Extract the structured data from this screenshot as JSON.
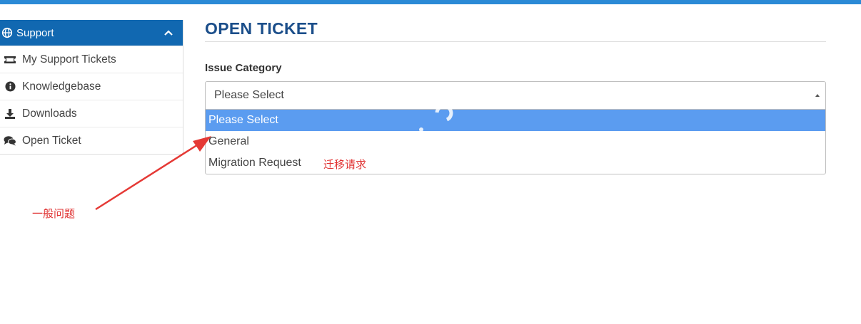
{
  "sidebar": {
    "header_label": "Support",
    "items": [
      {
        "label": "My Support Tickets",
        "icon": "ticket-icon"
      },
      {
        "label": "Knowledgebase",
        "icon": "info-circle-icon"
      },
      {
        "label": "Downloads",
        "icon": "download-icon"
      },
      {
        "label": "Open Ticket",
        "icon": "comments-icon"
      }
    ]
  },
  "main": {
    "title": "OPEN TICKET",
    "issue_category": {
      "label": "Issue Category",
      "selected": "Please Select",
      "options": [
        "Please Select",
        "General",
        "Migration Request"
      ]
    }
  },
  "annotations": {
    "migration_note": "迁移请求",
    "general_note": "一般问题"
  },
  "colors": {
    "top_bar": "#2b8ad6",
    "sidebar_header": "#1168b1",
    "title": "#1b4e8a",
    "option_highlight": "#5b9cf0",
    "annotation": "#e03131"
  }
}
